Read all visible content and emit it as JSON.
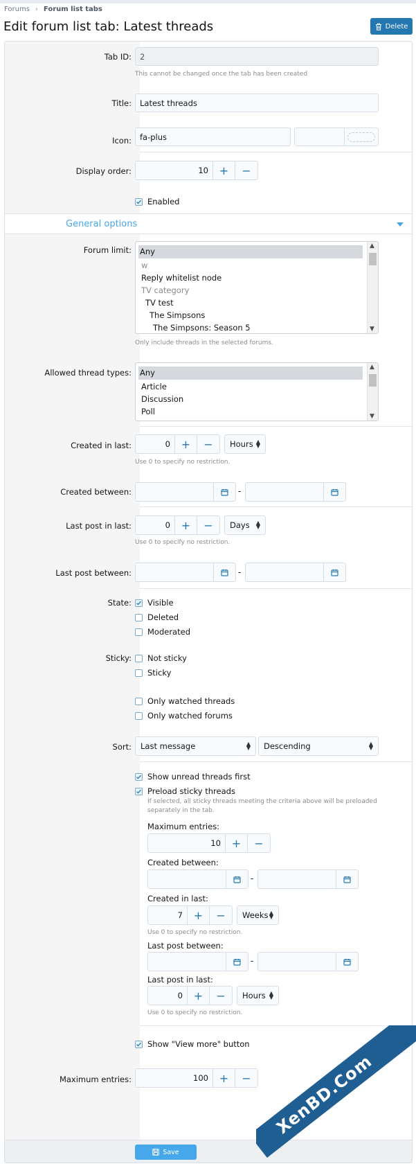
{
  "breadcrumb": {
    "items": [
      "Forums",
      "Forum list tabs"
    ]
  },
  "page": {
    "title": "Edit forum list tab: Latest threads",
    "delete_label": "Delete"
  },
  "fields": {
    "tab_id": {
      "label": "Tab ID:",
      "value": "2",
      "hint": "This cannot be changed once the tab has been created"
    },
    "title": {
      "label": "Title:",
      "value": "Latest threads"
    },
    "icon": {
      "label": "Icon:",
      "value": "fa-plus"
    },
    "display_order": {
      "label": "Display order:",
      "value": "10"
    },
    "enabled": {
      "label": "Enabled",
      "checked": true
    }
  },
  "section": {
    "label": "General options"
  },
  "forum_limit": {
    "label": "Forum limit:",
    "items": [
      "Any",
      "w",
      "Reply whitelist node",
      "TV category",
      "TV test",
      "The Simpsons",
      "The Simpsons: Season 5"
    ],
    "hint": "Only include threads in the selected forums."
  },
  "thread_types": {
    "label": "Allowed thread types:",
    "items": [
      "Any",
      "Article",
      "Discussion",
      "Poll"
    ]
  },
  "created_in_last": {
    "label": "Created in last:",
    "value": "0",
    "unit": "Hours",
    "hint": "Use 0 to specify no restriction."
  },
  "created_between": {
    "label": "Created between:",
    "sep": "-"
  },
  "last_post_in_last": {
    "label": "Last post in last:",
    "value": "0",
    "unit": "Days",
    "hint": "Use 0 to specify no restriction."
  },
  "last_post_between": {
    "label": "Last post between:",
    "sep": "-"
  },
  "state": {
    "label": "State:",
    "options": [
      {
        "label": "Visible",
        "checked": true
      },
      {
        "label": "Deleted",
        "checked": false
      },
      {
        "label": "Moderated",
        "checked": false
      }
    ]
  },
  "sticky": {
    "label": "Sticky:",
    "options": [
      {
        "label": "Not sticky",
        "checked": false
      },
      {
        "label": "Sticky",
        "checked": false
      }
    ]
  },
  "watched": {
    "options": [
      {
        "label": "Only watched threads",
        "checked": false
      },
      {
        "label": "Only watched forums",
        "checked": false
      }
    ]
  },
  "sort": {
    "label": "Sort:",
    "field": "Last message",
    "direction": "Descending"
  },
  "unread_first": {
    "label": "Show unread threads first",
    "checked": true
  },
  "preload": {
    "label": "Preload sticky threads",
    "checked": true,
    "hint1": "If selected, all sticky threads meeting the criteria above will be preloaded",
    "hint2": "separately in the tab.",
    "max_entries_label": "Maximum entries:",
    "max_entries": "10",
    "created_between_label": "Created between:",
    "created_in_last_label": "Created in last:",
    "created_in_last_value": "7",
    "created_in_last_unit": "Weeks",
    "created_hint": "Use 0 to specify no restriction.",
    "last_post_between_label": "Last post between:",
    "last_post_in_last_label": "Last post in last:",
    "last_post_in_last_value": "0",
    "last_post_in_last_unit": "Hours",
    "last_post_hint": "Use 0 to specify no restriction.",
    "sep": "-"
  },
  "view_more": {
    "label": "Show \"View more\" button",
    "checked": true
  },
  "maximum_entries": {
    "label": "Maximum entries:",
    "value": "100"
  },
  "footer": {
    "save_label": "Save"
  },
  "controls": {
    "plus": "+",
    "minus": "−"
  },
  "watermark": {
    "text": "XenBD.Com"
  },
  "colors": {
    "accent": "#2577b1",
    "link": "#47a7eb"
  }
}
